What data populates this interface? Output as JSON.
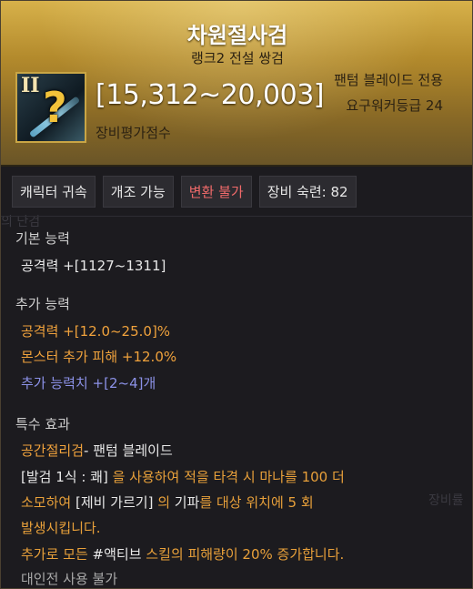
{
  "header": {
    "title": "차원절사검",
    "subtitle": "랭크2 전설 쌍검",
    "rank_numeral": "II",
    "attack_range": "[15,312~20,003]",
    "score_label": "장비평가점수",
    "required_class": "팬텀 블레이드 전용",
    "required_level": "요구워커등급 24"
  },
  "badges": [
    {
      "label": "캐릭터 귀속"
    },
    {
      "label": "개조 가능"
    },
    {
      "label": "변환 불가"
    },
    {
      "label": "장비 숙련: 82"
    }
  ],
  "basic": {
    "title": "기본 능력",
    "lines": [
      "공격력  +[1127~1311]"
    ]
  },
  "extra": {
    "title": "추가 능력",
    "lines": [
      "공격력  +[12.0~25.0]%",
      "몬스터 추가 피해  +12.0%",
      "추가 능력치 +[2~4]개"
    ]
  },
  "special": {
    "title": "특수 효과",
    "name": "공간절리검",
    "name_suffix": "- 팬텀 블레이드",
    "desc": [
      {
        "a": "[발검 1식 : 쾌]",
        "b": " 을 사용하여 적을 타격 시 마나를 100 더"
      },
      {
        "a": "소모하여 ",
        "b": "[제비 가르기]",
        "c": " 의 ",
        "d": "기파",
        "e": "를 대상 위치에 5 회"
      },
      {
        "a": "발생시킵니다."
      },
      {
        "a": "추가로 모든 ",
        "b": "#액티브",
        "c": " 스킬의 피해량이 20% 증가합니다."
      }
    ],
    "pvp_note": "대인전 사용 불가"
  },
  "background_ghost": {
    "left_text": "의 단검",
    "right_text": "장비률"
  },
  "colors": {
    "header_gold": "#c9a23f",
    "orange_text": "#f0a23c",
    "blue_text": "#8c92e8",
    "red_badge": "#f06a6a"
  }
}
